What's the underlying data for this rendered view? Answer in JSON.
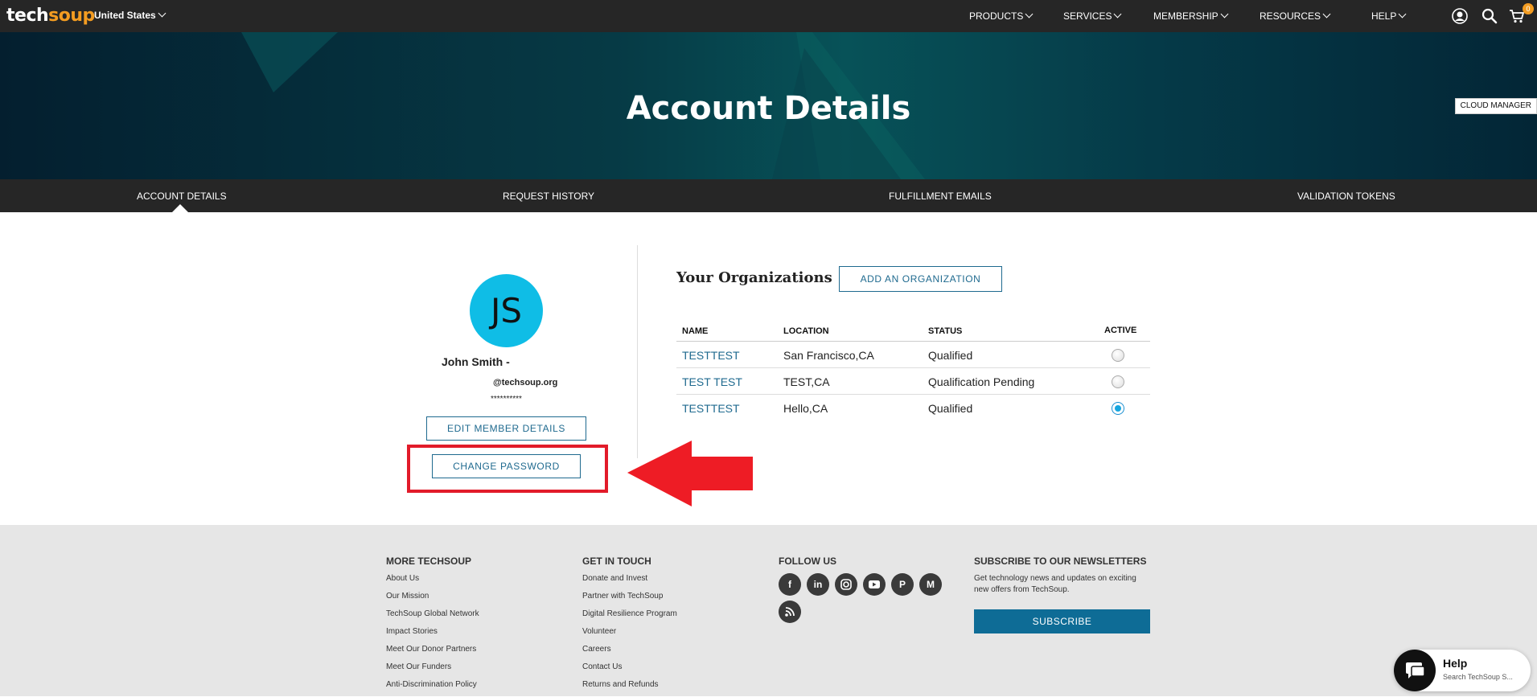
{
  "topnav": {
    "logo_part1": "tech",
    "logo_part2": "soup",
    "country": "United States",
    "menu": [
      "PRODUCTS",
      "SERVICES",
      "MEMBERSHIP",
      "RESOURCES",
      "HELP"
    ],
    "cart_count": "0"
  },
  "hero": {
    "title": "Account Details",
    "cloud_manager": "CLOUD MANAGER"
  },
  "tabs": [
    "ACCOUNT DETAILS",
    "REQUEST HISTORY",
    "FULFILLMENT EMAILS",
    "VALIDATION TOKENS"
  ],
  "member": {
    "initials": "JS",
    "name": "John Smith -",
    "email": "@techsoup.org",
    "password_mask": "**********",
    "edit_label": "EDIT MEMBER DETAILS",
    "change_password_label": "CHANGE PASSWORD"
  },
  "organizations": {
    "title": "Your Organizations",
    "add_label": "ADD AN ORGANIZATION",
    "headers": [
      "NAME",
      "LOCATION",
      "STATUS",
      "ACTIVE"
    ],
    "rows": [
      {
        "name": "TESTTEST",
        "location": "San Francisco,CA",
        "status": "Qualified",
        "active": false
      },
      {
        "name": "TEST TEST",
        "location": "TEST,CA",
        "status": "Qualification Pending",
        "active": false
      },
      {
        "name": "TESTTEST",
        "location": "Hello,CA",
        "status": "Qualified",
        "active": true
      }
    ]
  },
  "footer": {
    "more": {
      "title": "MORE TECHSOUP",
      "links": [
        "About Us",
        "Our Mission",
        "TechSoup Global Network",
        "Impact Stories",
        "Meet Our Donor Partners",
        "Meet Our Funders",
        "Anti-Discrimination Policy"
      ]
    },
    "contact": {
      "title": "GET IN TOUCH",
      "links": [
        "Donate and Invest",
        "Partner with TechSoup",
        "Digital Resilience Program",
        "Volunteer",
        "Careers",
        "Contact Us",
        "Returns and Refunds"
      ]
    },
    "follow": {
      "title": "FOLLOW US",
      "icons": [
        "facebook-icon",
        "linkedin-icon",
        "instagram-icon",
        "youtube-icon",
        "pinterest-icon",
        "medium-icon",
        "rss-icon"
      ]
    },
    "newsletter": {
      "title": "SUBSCRIBE TO OUR NEWSLETTERS",
      "text": "Get technology news and updates on exciting new offers from TechSoup.",
      "button": "SUBSCRIBE"
    }
  },
  "help_widget": {
    "title": "Help",
    "subtitle": "Search TechSoup S..."
  }
}
